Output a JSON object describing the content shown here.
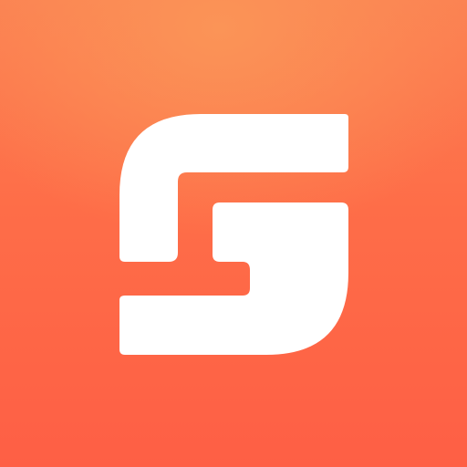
{
  "icon": {
    "name": "app-logo-icon",
    "colors": {
      "background_top": "#fb8052",
      "background_highlight": "#fb9457",
      "background_bottom": "#fe5f45",
      "glyph": "#ffffff"
    }
  }
}
